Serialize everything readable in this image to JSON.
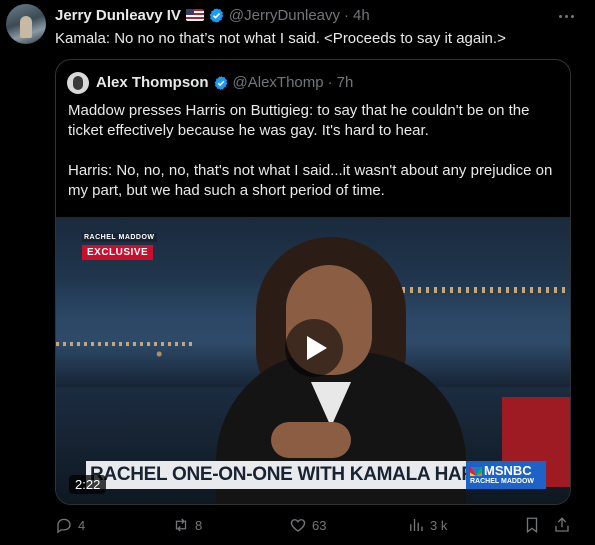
{
  "tweet": {
    "author_name": "Jerry Dunleavy IV",
    "flag_icon": "us-flag-icon",
    "handle": "@JerryDunleavy",
    "separator": "·",
    "time": "4h",
    "text": "Kamala: No no no that’s not what I said. <Proceeds to say it again.>",
    "verified_color": "#1d9bf0"
  },
  "quote": {
    "author_name": "Alex Thompson",
    "handle": "@AlexThomp",
    "separator": "·",
    "time": "7h",
    "paragraphs": [
      "Maddow presses Harris on Buttigieg: to say that he couldn't be on the ticket effectively because he was gay. It's hard to hear.",
      "Harris: No, no, no, that's not what I said...it wasn't about any prejudice on my part, but we had such a short period of time."
    ],
    "media": {
      "show_brand": "RACHEL MADDOW",
      "exclusive_label": "EXCLUSIVE",
      "lower_third": "RACHEL ONE-ON-ONE WITH KAMALA HARRIS",
      "network_logo": "MSNBC",
      "network_sub": "RACHEL MADDOW",
      "duration": "2:22"
    }
  },
  "actions": {
    "replies": "4",
    "reposts": "8",
    "likes": "63",
    "views": "3 k"
  }
}
